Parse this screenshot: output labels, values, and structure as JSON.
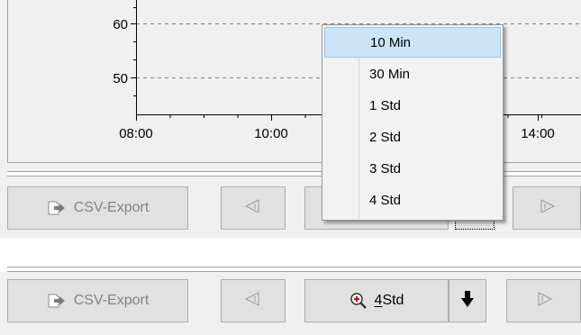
{
  "chart": {
    "y_ticks": [
      "60",
      "50"
    ],
    "x_ticks": [
      "08:00",
      "10:00",
      "14:00"
    ]
  },
  "toolbar_top": {
    "export_label": "CSV-Export"
  },
  "dropdown": {
    "items": [
      "10 Min",
      "30 Min",
      "1 Std",
      "2 Std",
      "3 Std",
      "4 Std"
    ],
    "selected_index": 0
  },
  "toolbar_bottom": {
    "export_label": "CSV-Export",
    "zoom_label": "4 Std",
    "zoom_mnemonic": "4"
  },
  "colors": {
    "panel_bg": "#f0f0f0",
    "button_bg": "#e1e1e1",
    "selection_bg": "#cce4f7",
    "selection_border": "#99c9ef",
    "disabled_text": "#838383",
    "zoom_icon_accent": "#d00000"
  },
  "icons": {
    "export": "export-icon",
    "prev": "arrow-left-icon",
    "next": "arrow-right-icon",
    "zoom": "magnifier-plus-icon",
    "dropdown": "triangle-down-icon"
  }
}
